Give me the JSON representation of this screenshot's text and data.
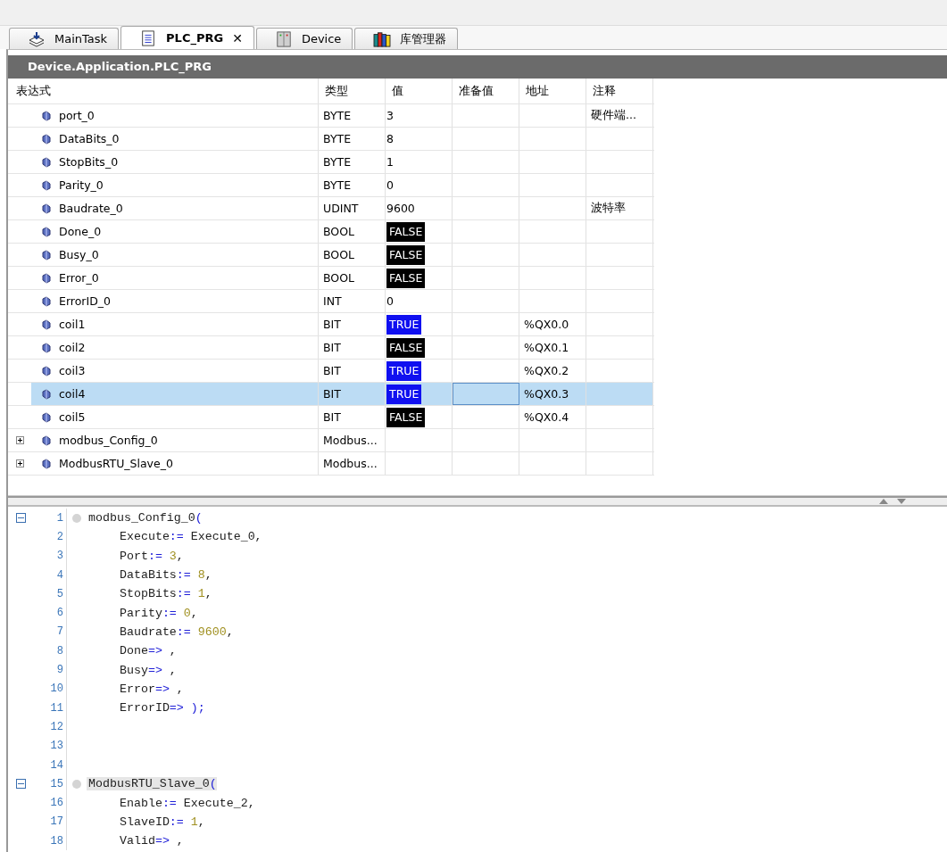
{
  "tabs": [
    {
      "label": "MainTask",
      "selected": false
    },
    {
      "label": "PLC_PRG",
      "selected": true,
      "close_glyph": "✕"
    },
    {
      "label": "Device",
      "selected": false
    },
    {
      "label": "库管理器",
      "selected": false
    }
  ],
  "path_title": "Device.Application.PLC_PRG",
  "table": {
    "columns": [
      "表达式",
      "类型",
      "值",
      "准备值",
      "地址",
      "注释"
    ],
    "rows": [
      {
        "name": "port_0",
        "type": "BYTE",
        "value": "3",
        "kind": "plain",
        "comment": "硬件端...",
        "selected": false
      },
      {
        "name": "DataBits_0",
        "type": "BYTE",
        "value": "8",
        "kind": "plain",
        "selected": false
      },
      {
        "name": "StopBits_0",
        "type": "BYTE",
        "value": "1",
        "kind": "plain",
        "selected": false
      },
      {
        "name": "Parity_0",
        "type": "BYTE",
        "value": "0",
        "kind": "plain",
        "selected": false
      },
      {
        "name": "Baudrate_0",
        "type": "UDINT",
        "value": "9600",
        "kind": "plain",
        "comment": "波特率",
        "selected": false
      },
      {
        "name": "Done_0",
        "type": "BOOL",
        "value": "FALSE",
        "kind": "bool_false",
        "selected": false
      },
      {
        "name": "Busy_0",
        "type": "BOOL",
        "value": "FALSE",
        "kind": "bool_false",
        "selected": false
      },
      {
        "name": "Error_0",
        "type": "BOOL",
        "value": "FALSE",
        "kind": "bool_false",
        "selected": false
      },
      {
        "name": "ErrorID_0",
        "type": "INT",
        "value": "0",
        "kind": "plain",
        "selected": false
      },
      {
        "name": "coil1",
        "type": "BIT",
        "value": "TRUE",
        "kind": "bool_true",
        "address": "%QX0.0",
        "selected": false
      },
      {
        "name": "coil2",
        "type": "BIT",
        "value": "FALSE",
        "kind": "bool_false",
        "address": "%QX0.1",
        "selected": false
      },
      {
        "name": "coil3",
        "type": "BIT",
        "value": "TRUE",
        "kind": "bool_true",
        "address": "%QX0.2",
        "selected": false
      },
      {
        "name": "coil4",
        "type": "BIT",
        "value": "TRUE",
        "kind": "bool_true",
        "address": "%QX0.3",
        "selected": true
      },
      {
        "name": "coil5",
        "type": "BIT",
        "value": "FALSE",
        "kind": "bool_false",
        "address": "%QX0.4",
        "selected": false
      },
      {
        "name": "modbus_Config_0",
        "type": "Modbus...",
        "expanded": false,
        "selected": false
      },
      {
        "name": "ModbusRTU_Slave_0",
        "type": "Modbus...",
        "expanded": false,
        "selected": false
      }
    ]
  },
  "code": [
    {
      "number": "1",
      "kind": "block_start",
      "highlight": false,
      "tokens": [
        {
          "t": "modbus_Config_0",
          "kind": "id"
        },
        {
          "t": "(",
          "kind": "op"
        }
      ]
    },
    {
      "number": "2",
      "kind": "param",
      "tokens": [
        {
          "t": "Execute",
          "kind": "id"
        },
        {
          "t": ":=",
          "kind": "op"
        },
        {
          "t": " Execute_0,",
          "kind": "id"
        }
      ]
    },
    {
      "number": "3",
      "kind": "param",
      "tokens": [
        {
          "t": "Port",
          "kind": "id"
        },
        {
          "t": ":=",
          "kind": "op"
        },
        {
          "t": " 3",
          "kind": "num"
        },
        {
          "t": ",",
          "kind": "id"
        }
      ]
    },
    {
      "number": "4",
      "kind": "param",
      "tokens": [
        {
          "t": "DataBits",
          "kind": "id"
        },
        {
          "t": ":=",
          "kind": "op"
        },
        {
          "t": " 8",
          "kind": "num"
        },
        {
          "t": ",",
          "kind": "id"
        }
      ]
    },
    {
      "number": "5",
      "kind": "param",
      "tokens": [
        {
          "t": "StopBits",
          "kind": "id"
        },
        {
          "t": ":=",
          "kind": "op"
        },
        {
          "t": " 1",
          "kind": "num"
        },
        {
          "t": ",",
          "kind": "id"
        }
      ]
    },
    {
      "number": "6",
      "kind": "param",
      "tokens": [
        {
          "t": "Parity",
          "kind": "id"
        },
        {
          "t": ":=",
          "kind": "op"
        },
        {
          "t": " 0",
          "kind": "num"
        },
        {
          "t": ",",
          "kind": "id"
        }
      ]
    },
    {
      "number": "7",
      "kind": "param",
      "tokens": [
        {
          "t": "Baudrate",
          "kind": "id"
        },
        {
          "t": ":=",
          "kind": "op"
        },
        {
          "t": " 9600",
          "kind": "num"
        },
        {
          "t": ",",
          "kind": "id"
        }
      ]
    },
    {
      "number": "8",
      "kind": "param",
      "tokens": [
        {
          "t": "Done",
          "kind": "id"
        },
        {
          "t": "=>",
          "kind": "op"
        },
        {
          "t": " ,",
          "kind": "id"
        }
      ]
    },
    {
      "number": "9",
      "kind": "param",
      "tokens": [
        {
          "t": "Busy",
          "kind": "id"
        },
        {
          "t": "=>",
          "kind": "op"
        },
        {
          "t": " ,",
          "kind": "id"
        }
      ]
    },
    {
      "number": "10",
      "kind": "param",
      "tokens": [
        {
          "t": "Error",
          "kind": "id"
        },
        {
          "t": "=>",
          "kind": "op"
        },
        {
          "t": " ,",
          "kind": "id"
        }
      ]
    },
    {
      "number": "11",
      "kind": "param",
      "tokens": [
        {
          "t": "ErrorID",
          "kind": "id"
        },
        {
          "t": "=>",
          "kind": "op"
        },
        {
          "t": " );",
          "kind": "op"
        }
      ]
    },
    {
      "number": "12",
      "kind": "blank"
    },
    {
      "number": "13",
      "kind": "blank"
    },
    {
      "number": "14",
      "kind": "blank"
    },
    {
      "number": "15",
      "kind": "block_start",
      "highlight": true,
      "tokens": [
        {
          "t": "ModbusRTU_Slave_0",
          "kind": "id"
        },
        {
          "t": "(",
          "kind": "op"
        }
      ]
    },
    {
      "number": "16",
      "kind": "param",
      "tokens": [
        {
          "t": "Enable",
          "kind": "id"
        },
        {
          "t": ":=",
          "kind": "op"
        },
        {
          "t": " Execute_2,",
          "kind": "id"
        }
      ]
    },
    {
      "number": "17",
      "kind": "param",
      "tokens": [
        {
          "t": "SlaveID",
          "kind": "id"
        },
        {
          "t": ":=",
          "kind": "op"
        },
        {
          "t": " 1",
          "kind": "num"
        },
        {
          "t": ",",
          "kind": "id"
        }
      ]
    },
    {
      "number": "18",
      "kind": "param",
      "tokens": [
        {
          "t": "Valid",
          "kind": "id"
        },
        {
          "t": "=>",
          "kind": "op"
        },
        {
          "t": " ,",
          "kind": "id"
        }
      ]
    }
  ]
}
